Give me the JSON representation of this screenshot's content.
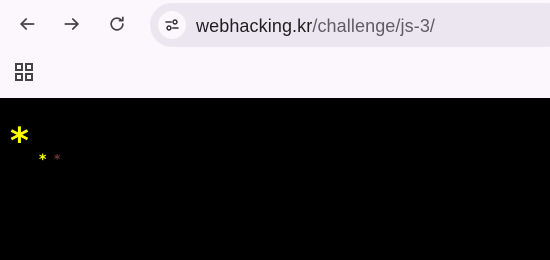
{
  "browser": {
    "back_icon": "arrow-left-icon",
    "forward_icon": "arrow-right-icon",
    "reload_icon": "reload-icon",
    "site_info_icon": "tune-icon",
    "apps_icon": "apps-grid-icon",
    "url_host": "webhacking.kr",
    "url_path": "/challenge/js-3/"
  },
  "page": {
    "background_color": "#000000",
    "stars": [
      {
        "text": "*",
        "color": "#ffff00"
      },
      {
        "text": "*",
        "color": "#ffff00"
      },
      {
        "text": "*",
        "color": "#6b3a3a"
      }
    ]
  }
}
